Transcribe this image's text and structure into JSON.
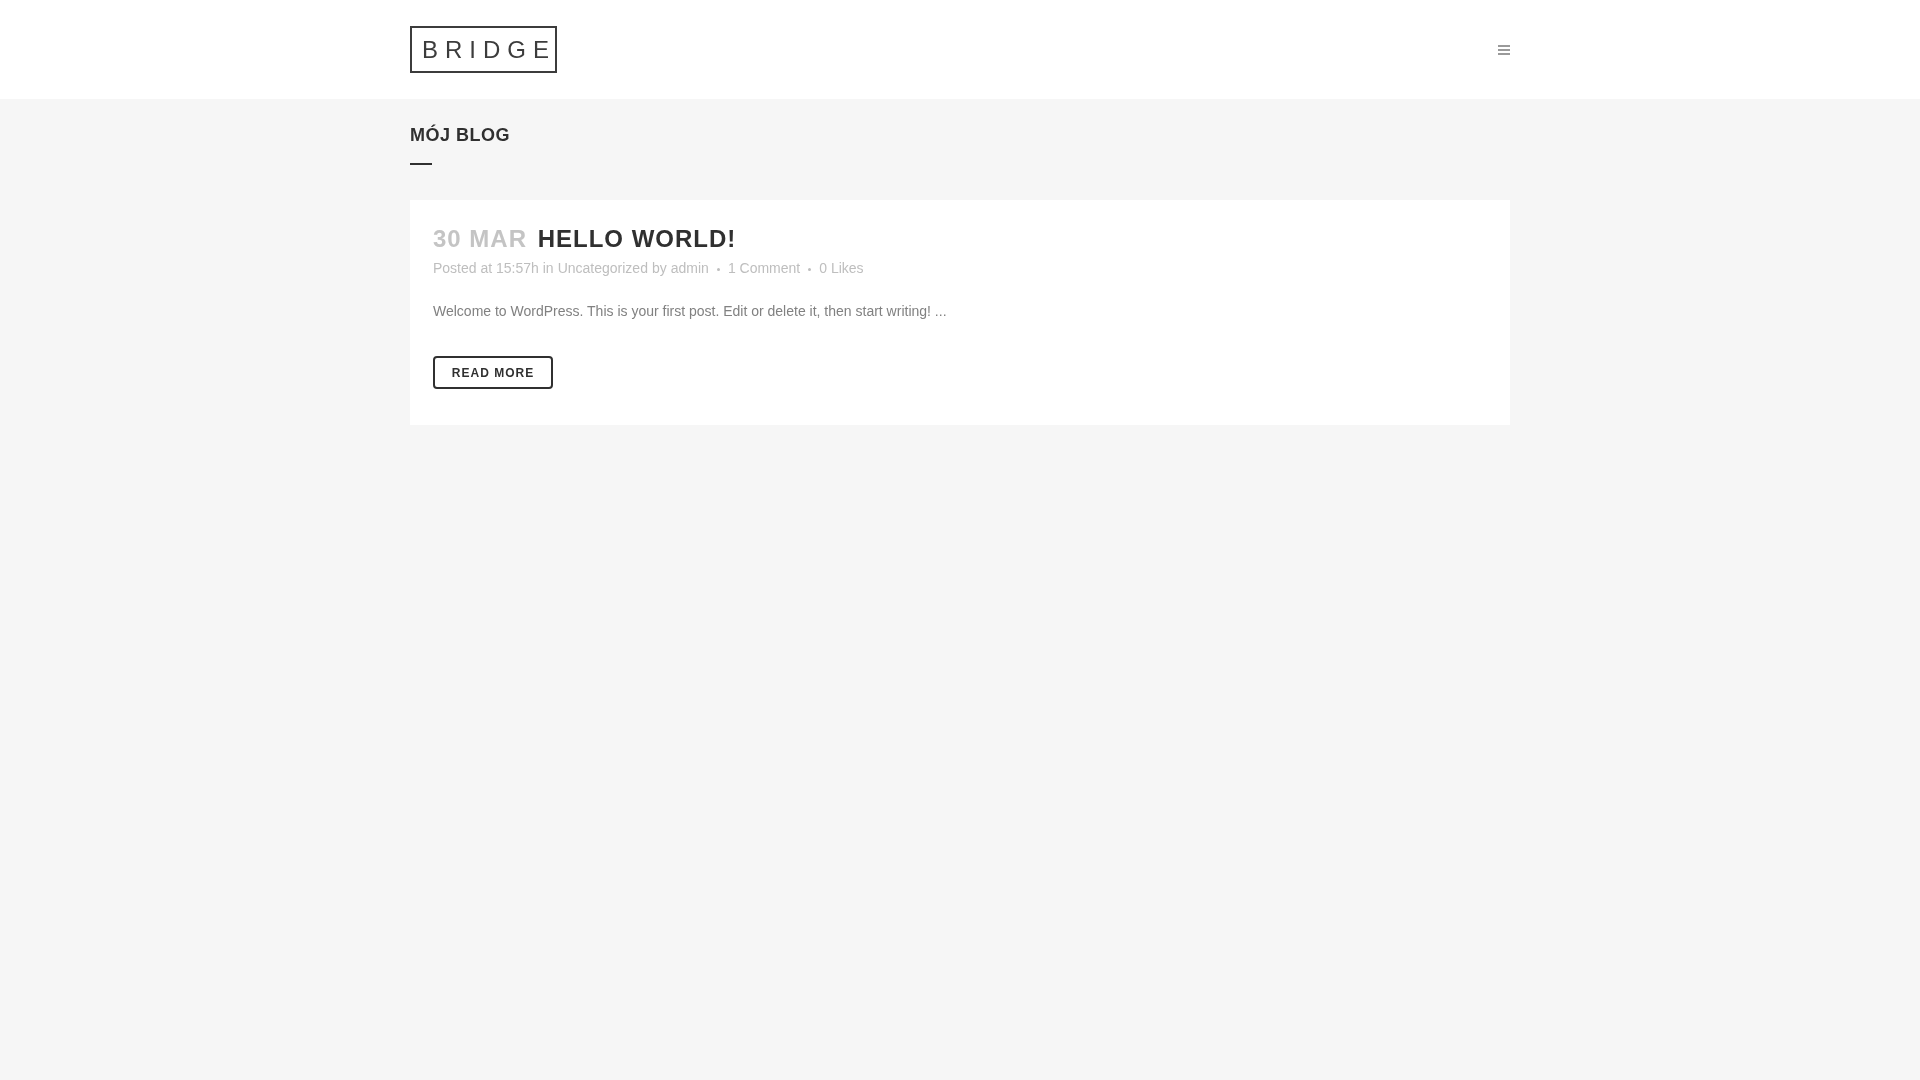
{
  "header": {
    "logo": "BRIDGE"
  },
  "page_title": "MÓJ BLOG",
  "posts": [
    {
      "date": "30 MAR",
      "title": "HELLO WORLD!",
      "meta": {
        "posted": "Posted at 15:57h in",
        "category": "Uncategorized",
        "by_label": "by",
        "author": "admin",
        "comments": "1 Comment",
        "likes": "0 Likes"
      },
      "excerpt": "Welcome to WordPress. This is your first post. Edit or delete it, then start writing! ...",
      "button": "READ MORE"
    }
  ]
}
